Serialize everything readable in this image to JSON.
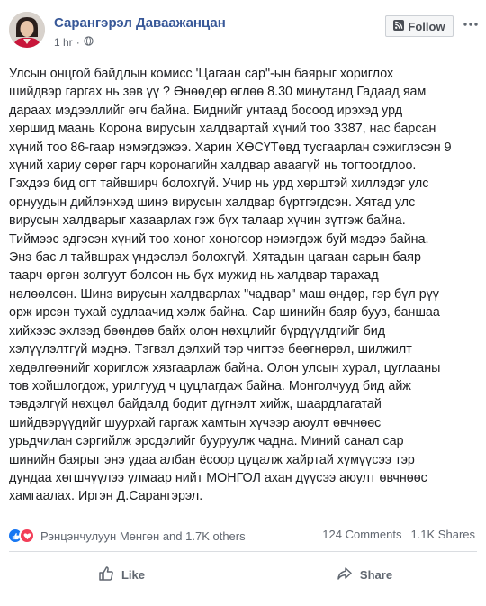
{
  "post": {
    "author": "Сарангэрэл Даваажанцан",
    "time": "1 hr",
    "follow_label": "Follow",
    "text": "Улсын онцгой байдлын комисс 'Цагаан сар\"-ын баярыг хориглох\nшийдвэр гаргах нь зөв үү ? Өнөөдөр өглөө 8.30 минутанд Гадаад яам\nдараах мэдээллийг өгч байна. Биднийг унтаад босоод ирэхэд урд\nхөршид маань Корона вирусын халдвартай хүний тоо 3387, нас барсан\nхүний тоо 86-гаар нэмэгдэжээ. Харин ХӨСҮТөвд тусгаарлан сэжиглэсэн 9\nхүний хариу сөрөг гарч коронагийн халдвар аваагүй нь тогтоогдлоо.\nГэхдээ бид огт тайвширч болохгүй. Учир нь урд хөрштэй хиллэдэг улс\nорнуудын дийлэнхэд шинэ вирусын халдвар бүртгэгдсэн. Хятад улс\nвирусын халдварыг хазаарлах гэж бүх талаар хүчин зүтгэж байна.\nТиймээс эдгэсэн хүний тоо хоног хоногоор нэмэгдэж буй мэдээ байна.\nЭнэ бас л тайвшрах үндэслэл болохгүй. Хятадын цагаан сарын баяр\nтаарч өргөн золгуут болсон нь бүх мужид нь халдвар тарахад\nнөлөөлсөн. Шинэ вирусын халдварлах \"чадвар\" маш өндөр, гэр бүл рүү\nорж ирсэн тухай судлаачид хэлж байна. Сар шинийн баяр бууз, баншаа\nхийхээс эхлээд бөөндөө байх олон нөхцлийг бүрдүүлдгийг бид\nхэлүүлэлтгүй мэднэ. Тэгвэл дэлхий тэр чигтээ бөөгнөрөл, шилжилт\nхөдөлгөөнийг хориглож хязгаарлаж байна. Олон улсын хурал, цуглааны\nтов хойшлогдож, урилгууд ч цуцлагдаж байна. Монголчууд бид айж\nтэвдэлгүй нөхцөл байдалд бодит дүгнэлт хийж, шаардлагатай\nшийдвэрүүдийг шуурхай гаргаж хамтын хүчээр аюулт өвчнөөс\nурьдчилан сэргийлж эрсдэлийг бууруулж чадна. Миний санал сар\nшинийн баярыг энэ удаа албан ёсоор цуцалж хайртай хүмүүсээ тэр\nдундаа хөгшчүүлээ улмаар нийт МОНГОЛ ахан дүүсээ аюулт өвчнөөс\nхамгаалах. Иргэн Д.Сарангэрэл."
  },
  "stats": {
    "reactions_text": "Рэнцэнчулуун Мөнгөн and 1.7K others",
    "comments": "124 Comments",
    "shares": "1.1K Shares"
  },
  "actions": {
    "like_label": "Like",
    "share_label": "Share"
  },
  "colors": {
    "author_link": "#385898",
    "like_blue": "#1877f2",
    "heart_red": "#f33e58"
  },
  "icons": [
    "avatar",
    "globe-icon",
    "rss-icon",
    "more-icon",
    "like-reaction-icon",
    "love-reaction-icon",
    "thumbs-up-icon",
    "share-arrow-icon"
  ]
}
